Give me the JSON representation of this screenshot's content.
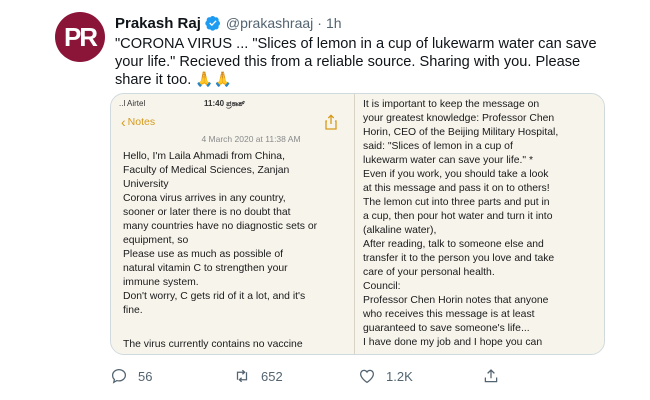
{
  "tweet": {
    "author_name": "Prakash Raj",
    "handle": "@prakashraaj",
    "separator": "·",
    "time": "1h",
    "lines": [
      "\"CORONA VIRUS ... \"Slices of lemon in a cup of lukewarm water can save",
      "your life.\"  Recieved this from a reliable source. Sharing with you. Please",
      "share it too. 🙏🙏"
    ]
  },
  "media": {
    "statusbar": {
      "carrier": "..l Airtel",
      "time": "11:40 ಪ್ರಕಾಶ್",
      "right": ""
    },
    "back_label": "Notes",
    "note_date": "4 March 2020 at 11:38 AM",
    "left_lines": [
      "Hello, I'm Laila Ahmadi from China,",
      "Faculty of Medical Sciences, Zanjan",
      "University",
      "  Corona virus arrives in any country,",
      "sooner or later there is no doubt that",
      "many countries have no diagnostic sets or",
      "equipment, so",
      "  Please use as much as possible of",
      "natural vitamin C to strengthen your",
      "immune system.",
      "  Don't worry, C gets rid of it a lot, and it's",
      "fine."
    ],
    "left_last": "  The virus currently contains no vaccine",
    "right_lines": [
      "It is important to keep the message on",
      "your greatest knowledge: Professor Chen",
      "Horin, CEO of the Beijing Military Hospital,",
      "said: \"Slices of lemon in a cup of",
      "lukewarm water can save your life.\" *",
      "  Even if you work, you should take a look",
      "at this message and pass it on to others!",
      "The lemon cut into three parts and put in",
      "a cup, then pour hot water and turn it into",
      "(alkaline water),",
      "  After reading, talk to someone else and",
      "transfer it to the person you love and take",
      "care of your personal health.",
      "  Council:",
      "  Professor Chen Horin notes that anyone",
      "who receives this message is at least",
      "guaranteed to save someone's life...",
      "  I have done my job and I hope you can"
    ]
  },
  "actions": {
    "reply_count": "56",
    "retweet_count": "652",
    "like_count": "1.2K"
  },
  "colors": {
    "avatar_bg": "#8a1538",
    "verified": "#1d9bf0",
    "notes_accent": "#d69a1b",
    "secondary_text": "#536471"
  },
  "icons": [
    "verified-badge-icon",
    "share-icon",
    "reply-icon",
    "retweet-icon",
    "like-icon",
    "upload-icon"
  ]
}
